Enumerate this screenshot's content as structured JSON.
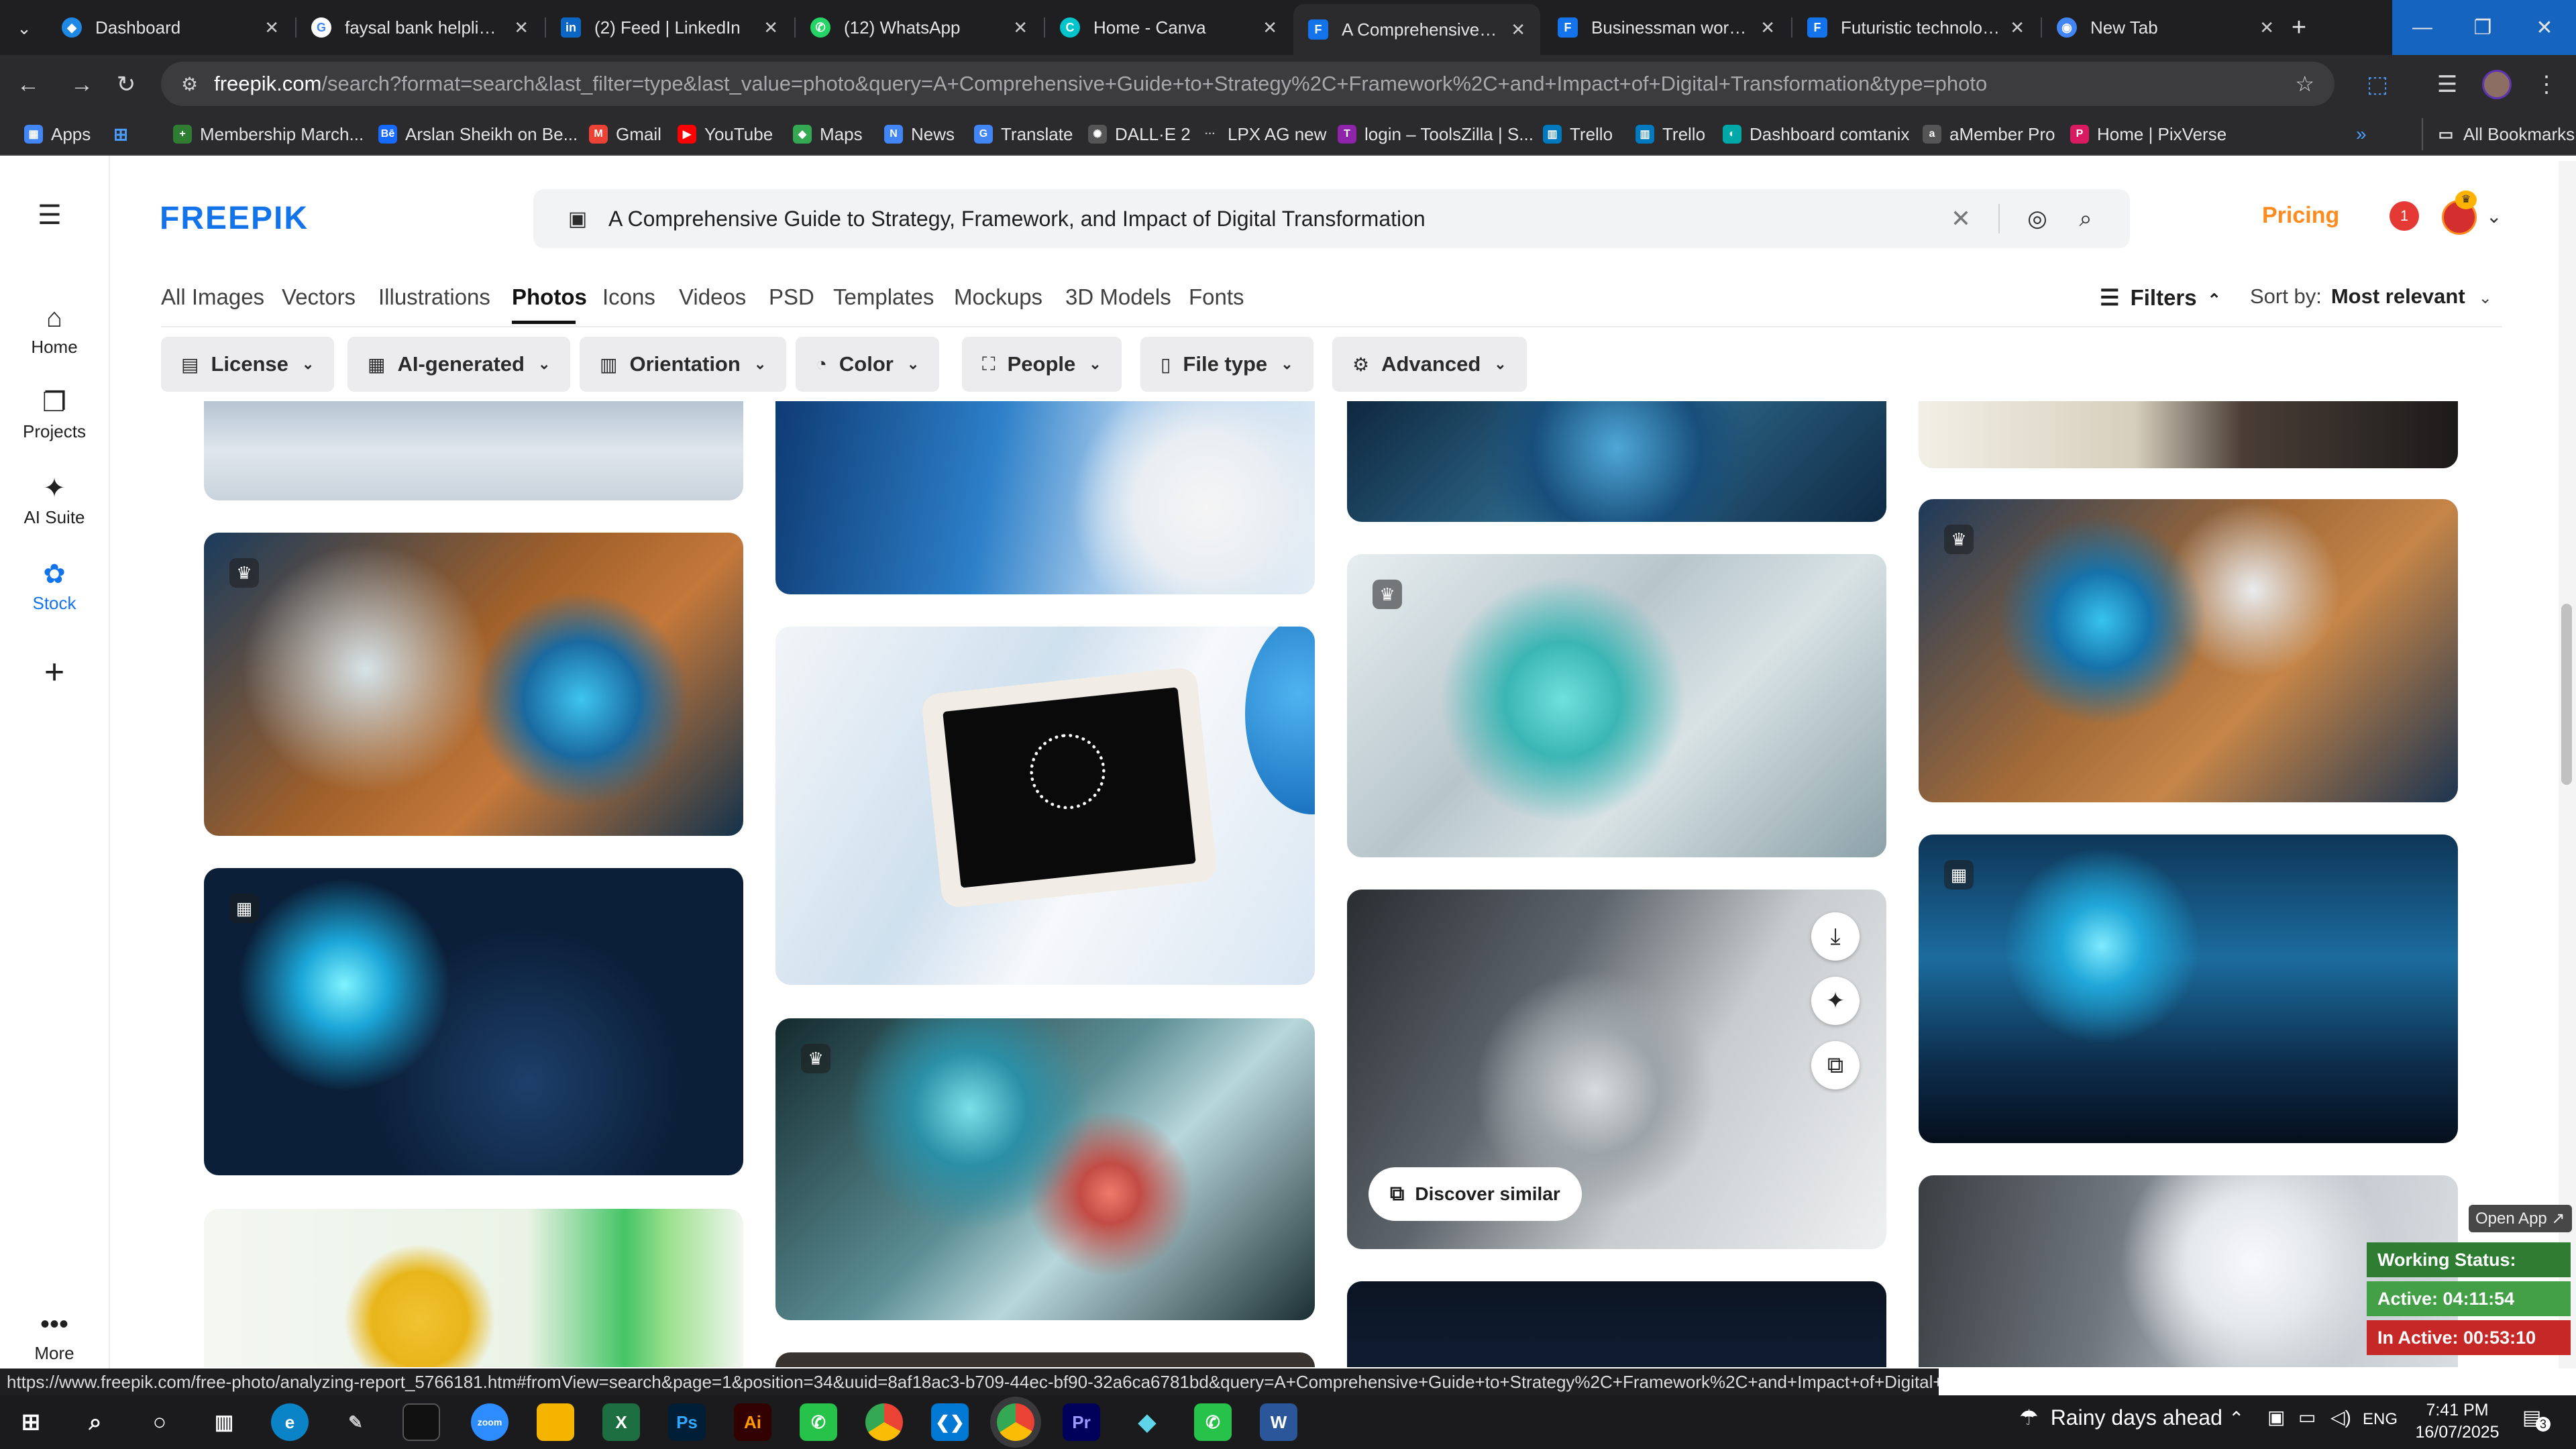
{
  "browser": {
    "tabs": [
      {
        "title": "Dashboard",
        "icon": "dashboard-favicon",
        "color": "#1e88e5"
      },
      {
        "title": "faysal bank helpline -",
        "icon": "google-favicon",
        "color": "#ffffff"
      },
      {
        "title": "(2) Feed | LinkedIn",
        "icon": "linkedin-favicon",
        "color": "#0a66c2"
      },
      {
        "title": "(12) WhatsApp",
        "icon": "whatsapp-favicon",
        "color": "#25d366"
      },
      {
        "title": "Home - Canva",
        "icon": "canva-favicon",
        "color": "#00c4cc"
      },
      {
        "title": "A Comprehensive Gu",
        "icon": "freepik-favicon",
        "color": "#1273eb"
      },
      {
        "title": "Businessman working",
        "icon": "freepik-favicon",
        "color": "#1273eb"
      },
      {
        "title": "Futuristic technology",
        "icon": "freepik-favicon",
        "color": "#1273eb"
      },
      {
        "title": "New Tab",
        "icon": "chrome-favicon",
        "color": "#4285f4"
      }
    ],
    "url_host": "freepik.com",
    "url_path": "/search?format=search&last_filter=type&last_value=photo&query=A+Comprehensive+Guide+to+Strategy%2C+Framework%2C+and+Impact+of+Digital+Transformation&type=photo",
    "bookmarks": [
      {
        "label": "Apps",
        "icon": "apps-grid-icon",
        "color": "#4285f4"
      },
      {
        "label": "Membership March...",
        "icon": "bookmark-green-icon",
        "color": "#2e7d32"
      },
      {
        "label": "Arslan Sheikh on Be...",
        "icon": "behance-icon",
        "color": "#1769ff"
      },
      {
        "label": "Gmail",
        "icon": "gmail-icon",
        "color": "#ea4335"
      },
      {
        "label": "YouTube",
        "icon": "youtube-icon",
        "color": "#ff0000"
      },
      {
        "label": "Maps",
        "icon": "maps-icon",
        "color": "#34a853"
      },
      {
        "label": "News",
        "icon": "news-icon",
        "color": "#4285f4"
      },
      {
        "label": "Translate",
        "icon": "translate-icon",
        "color": "#4285f4"
      },
      {
        "label": "DALL·E 2",
        "icon": "openai-icon",
        "color": "#555555"
      },
      {
        "label": "LPX AG new",
        "icon": "dots-icon",
        "color": "#555555"
      },
      {
        "label": "login – ToolsZilla | S...",
        "icon": "toolszilla-icon",
        "color": "#8e24aa"
      },
      {
        "label": "Trello",
        "icon": "trello-icon",
        "color": "#0079bf"
      },
      {
        "label": "Trello",
        "icon": "trello-icon",
        "color": "#0079bf"
      },
      {
        "label": "Dashboard comtanix",
        "icon": "comtanix-icon",
        "color": "#00a8a8"
      },
      {
        "label": "aMember Pro",
        "icon": "amember-icon",
        "color": "#555555"
      },
      {
        "label": "Home | PixVerse",
        "icon": "pixverse-icon",
        "color": "#d81b60"
      }
    ],
    "all_bookmarks": "All Bookmarks",
    "status_url": "https://www.freepik.com/free-photo/analyzing-report_5766181.htm#fromView=search&page=1&position=34&uuid=8af18ac3-b709-44ec-bf90-32a6ca6781bd&query=A+Comprehensive+Guide+to+Strategy%2C+Framework%2C+and+Impact+of+Digital+Transformation"
  },
  "rail": {
    "items": [
      {
        "label": "Home",
        "icon": "home-icon"
      },
      {
        "label": "Projects",
        "icon": "projects-icon"
      },
      {
        "label": "AI Suite",
        "icon": "sparkle-icon"
      },
      {
        "label": "Stock",
        "icon": "stock-icon"
      }
    ],
    "more_label": "More"
  },
  "header": {
    "logo": "FREEPIK",
    "search_value": "A Comprehensive Guide to Strategy, Framework, and Impact of Digital Transformation",
    "pricing": "Pricing",
    "notification_count": "1",
    "accent": "#ff8a1e",
    "brand": "#1273eb"
  },
  "categories": [
    "All Images",
    "Vectors",
    "Illustrations",
    "Photos",
    "Icons",
    "Videos",
    "PSD",
    "Templates",
    "Mockups",
    "3D Models",
    "Fonts"
  ],
  "active_category": "Photos",
  "filters_label": "Filters",
  "sort": {
    "label": "Sort by:",
    "value": "Most relevant"
  },
  "chips": [
    {
      "label": "License",
      "icon": "license-icon"
    },
    {
      "label": "AI-generated",
      "icon": "ai-generated-icon"
    },
    {
      "label": "Orientation",
      "icon": "orientation-icon"
    },
    {
      "label": "Color",
      "icon": "color-icon"
    },
    {
      "label": "People",
      "icon": "people-icon"
    },
    {
      "label": "File type",
      "icon": "file-type-icon"
    },
    {
      "label": "Advanced",
      "icon": "advanced-icon"
    }
  ],
  "gallery": {
    "discover_similar": "Discover similar",
    "hover_actions": [
      "download-icon",
      "magic-edit-icon",
      "add-to-collection-icon"
    ]
  },
  "widget": {
    "open_app": "Open App ↗",
    "status": "Working Status: Active",
    "active": "Active: 04:11:54",
    "inactive": "In Active: 00:53:10"
  },
  "taskbar": {
    "weather": "Rainy days ahead",
    "lang": "ENG",
    "time": "7:41 PM",
    "date": "16/07/2025",
    "notification_count": "3"
  }
}
